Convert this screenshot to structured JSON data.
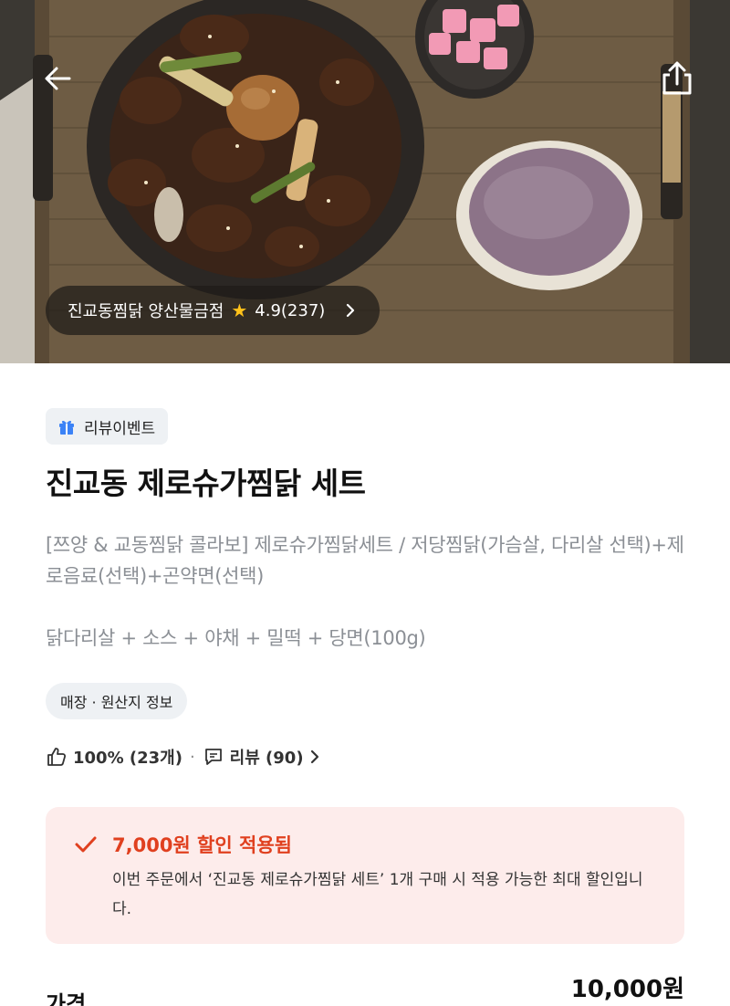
{
  "hero": {
    "image_icon": "braised-chicken-photo",
    "back_icon": "arrow-left-icon",
    "share_icon": "share-icon"
  },
  "store": {
    "name": "진교동찜닭 양산물금점",
    "rating": "4.9",
    "review_count": "(237)"
  },
  "badge": {
    "label": "리뷰이벤트",
    "icon": "gift-icon"
  },
  "product": {
    "title": "진교동 제로슈가찜닭 세트",
    "description": "[쯔양 & 교동찜닭 콜라보] 제로슈가찜닭세트 / 저당찜닭(가슴살, 다리살 선택)+제로음료(선택)+곤약면(선택)",
    "components": "닭다리살 + 소스 + 야채 + 밀떡 + 당면(100g)"
  },
  "origin_chip": {
    "label": "매장 · 원산지 정보"
  },
  "stats": {
    "like_label": "100% (23개)",
    "separator": "·",
    "review_label": "리뷰 (90)"
  },
  "discount": {
    "title": "7,000원 할인 적용됨",
    "text": "이번 주문에서 ‘진교동 제로슈가찜닭 세트’ 1개 구매 시 적용 가능한 최대 할인입니다.",
    "accent": "#e0401f",
    "background": "#fdeceb"
  },
  "price": {
    "label": "가격",
    "value": "10,000원"
  }
}
